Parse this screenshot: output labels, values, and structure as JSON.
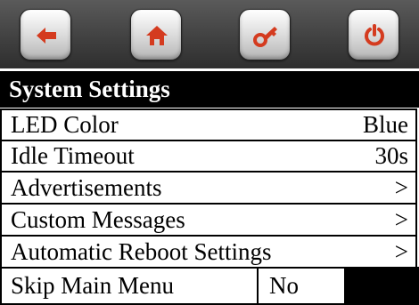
{
  "header": {
    "title": "System Settings"
  },
  "toolbar": {
    "buttons": [
      {
        "icon": "back-arrow-icon"
      },
      {
        "icon": "home-icon"
      },
      {
        "icon": "key-icon"
      },
      {
        "icon": "power-icon"
      }
    ]
  },
  "settings": {
    "led_color": {
      "label": "LED Color",
      "value": "Blue"
    },
    "idle_timeout": {
      "label": "Idle Timeout",
      "value": "30s"
    },
    "advertisements": {
      "label": "Advertisements",
      "value": ">"
    },
    "custom_messages": {
      "label": "Custom Messages",
      "value": ">"
    },
    "auto_reboot": {
      "label": "Automatic Reboot Settings",
      "value": ">"
    },
    "skip_main_menu": {
      "label": "Skip Main Menu",
      "value": "No"
    }
  },
  "colors": {
    "toolbar": "#3f3f3f",
    "accent": "#d43b1f",
    "title_bg": "#000000",
    "row_bg": "#ffffff"
  }
}
